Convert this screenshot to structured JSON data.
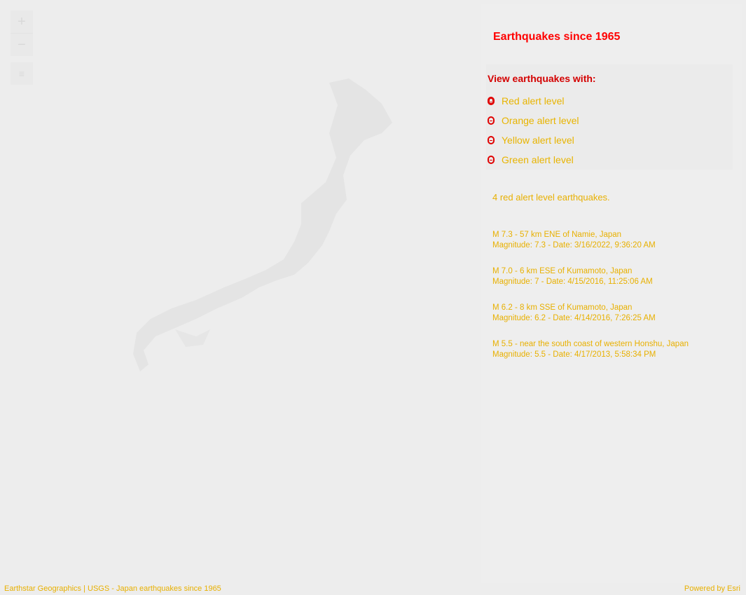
{
  "map": {
    "zoom_in_label": "+",
    "zoom_out_label": "−",
    "layers_icon": "≡"
  },
  "panel": {
    "title": "Earthquakes since 1965",
    "filter_title": "View earthquakes with:",
    "options": [
      {
        "label": "Red alert level",
        "selected": true
      },
      {
        "label": "Orange alert level",
        "selected": false
      },
      {
        "label": "Yellow alert level",
        "selected": false
      },
      {
        "label": "Green alert level",
        "selected": false
      }
    ],
    "summary": "4 red alert level earthquakes.",
    "earthquakes": [
      {
        "title": "M 7.3 - 57 km ENE of Namie, Japan",
        "detail": "Magnitude: 7.3 - Date: 3/16/2022, 9:36:20 AM"
      },
      {
        "title": "M 7.0 - 6 km ESE of Kumamoto, Japan",
        "detail": "Magnitude: 7 - Date: 4/15/2016, 11:25:06 AM"
      },
      {
        "title": "M 6.2 - 8 km SSE of Kumamoto, Japan",
        "detail": "Magnitude: 6.2 - Date: 4/14/2016, 7:26:25 AM"
      },
      {
        "title": "M 5.5 - near the south coast of western Honshu, Japan",
        "detail": "Magnitude: 5.5 - Date: 4/17/2013, 5:58:34 PM"
      }
    ]
  },
  "footer": {
    "attribution": "Earthstar Geographics | USGS - Japan earthquakes since 1965",
    "powered_by": "Powered by Esri"
  }
}
